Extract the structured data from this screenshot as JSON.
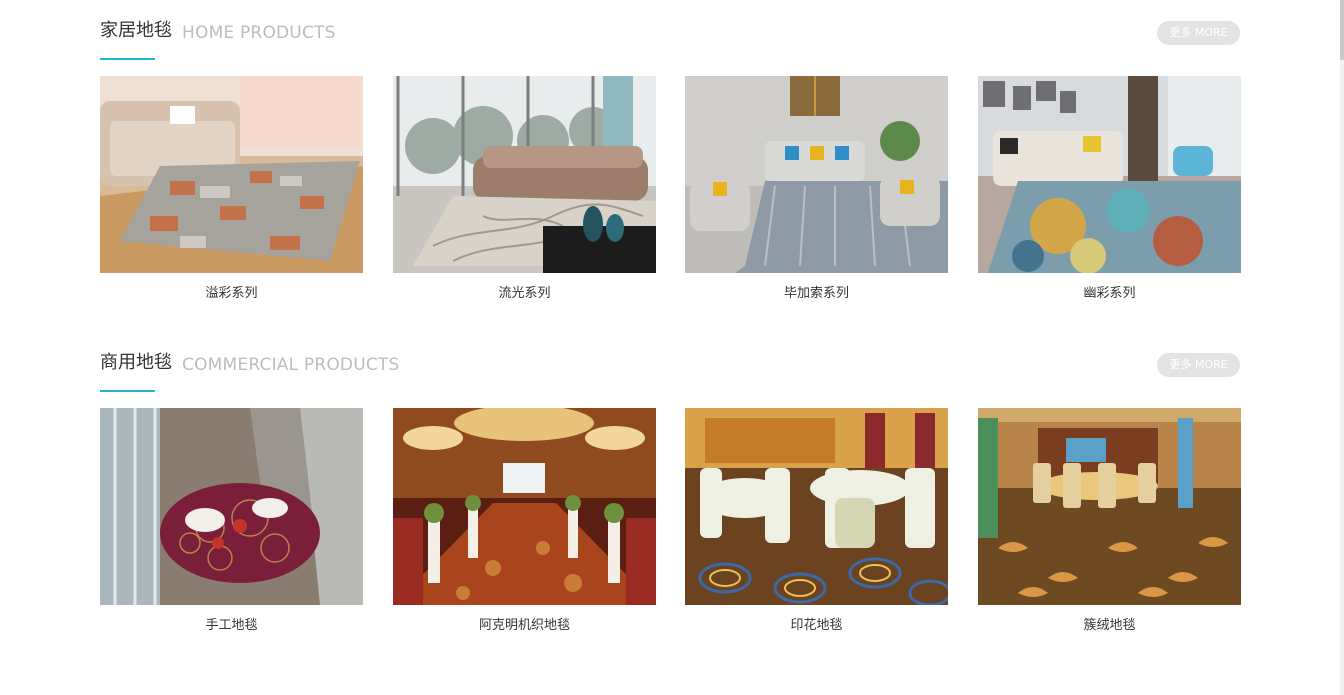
{
  "sections": [
    {
      "title_cn": "家居地毯",
      "title_en": "HOME PRODUCTS",
      "more_label": "更多 MORE",
      "products": [
        {
          "name": "溢彩系列",
          "image": "living-room-patchwork-rug-photo"
        },
        {
          "name": "流光系列",
          "image": "living-room-branch-pattern-rug-photo"
        },
        {
          "name": "毕加索系列",
          "image": "living-room-abstract-blue-rug-photo"
        },
        {
          "name": "幽彩系列",
          "image": "living-room-colorful-abstract-rug-photo"
        }
      ]
    },
    {
      "title_cn": "商用地毯",
      "title_en": "COMMERCIAL PRODUCTS",
      "more_label": "更多 MORE",
      "products": [
        {
          "name": "手工地毯",
          "image": "lobby-round-handmade-rug-photo"
        },
        {
          "name": "阿克明机织地毯",
          "image": "banquet-hall-axminster-carpet-photo"
        },
        {
          "name": "印花地毯",
          "image": "dining-hall-printed-carpet-photo"
        },
        {
          "name": "簇绒地毯",
          "image": "restaurant-tufted-carpet-photo"
        }
      ]
    }
  ],
  "colors": {
    "accent": "#1fb5cc",
    "more_button_bg": "#e3e3e3",
    "title_en": "#bdbdbd"
  }
}
